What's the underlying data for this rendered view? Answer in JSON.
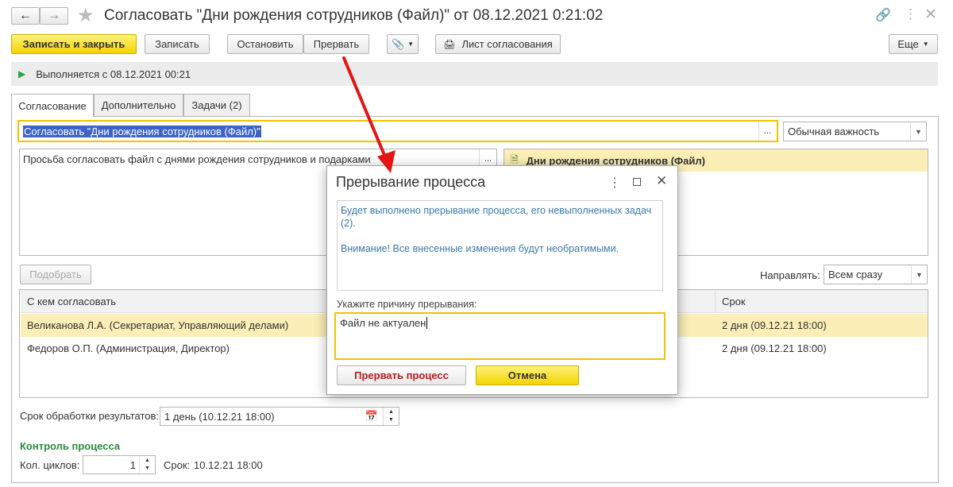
{
  "window": {
    "title": "Согласовать \"Дни рождения сотрудников (Файл)\" от 08.12.2021 0:21:02"
  },
  "toolbar": {
    "save_close": "Записать и закрыть",
    "save": "Записать",
    "stop": "Остановить",
    "interrupt": "Прервать",
    "approval_sheet": "Лист согласования",
    "more": "Еще"
  },
  "status": {
    "text": "Выполняется с 08.12.2021 00:21"
  },
  "tabs": [
    {
      "label": "Согласование"
    },
    {
      "label": "Дополнительно"
    },
    {
      "label": "Задачи (2)"
    }
  ],
  "form": {
    "subject": "Согласовать \"Дни рождения сотрудников (Файл)\"",
    "importance": "Обычная важность",
    "description": "Просьба согласовать файл с днями рождения сотрудников и подарками",
    "attachment": "Дни рождения сотрудников (Файл)",
    "pick_button": "Подобрать",
    "send_label": "Направлять:",
    "send_value": "Всем сразу",
    "processing_label": "Срок обработки результатов:",
    "processing_value": "1 день (10.12.21 18:00)",
    "control_heading": "Контроль процесса",
    "cycles_label": "Кол. циклов:",
    "cycles_value": "1",
    "deadline_label": "Срок:",
    "deadline_value": "10.12.21 18:00"
  },
  "table": {
    "headers": [
      "С кем согласовать",
      "Срок"
    ],
    "rows": [
      {
        "who": "Великанова Л.А. (Секретариат, Управляющий делами)",
        "term": "2 дня (09.12.21 18:00)"
      },
      {
        "who": "Федоров О.П. (Администрация, Директор)",
        "term": "2 дня (09.12.21 18:00)"
      }
    ]
  },
  "dialog": {
    "title": "Прерывание процесса",
    "message_line1": "Будет выполнено прерывание процесса, его невыполненных задач (2).",
    "message_line2": "Внимание! Все внесенные изменения будут необратимыми.",
    "reason_label": "Укажите причину прерывания:",
    "reason_value": "Файл не актуален",
    "interrupt_button": "Прервать процесс",
    "cancel_button": "Отмена"
  },
  "colors": {
    "accent_yellow": "#f3d400",
    "selection_row": "#fbeeb6",
    "dialog_text": "#3a7aa8",
    "danger_text": "#b21d1d",
    "green_heading": "#2c8a3c",
    "arrow_red": "#e31515"
  }
}
